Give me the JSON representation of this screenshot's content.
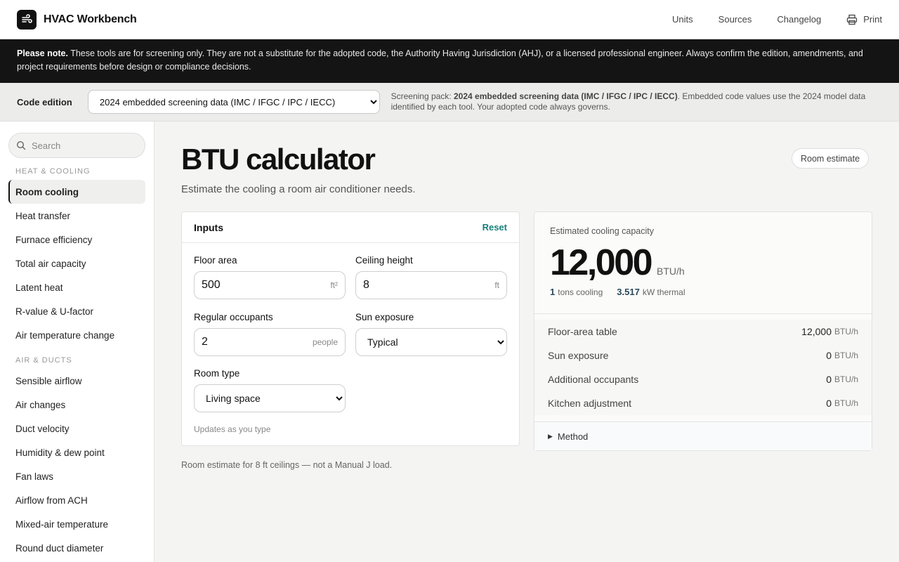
{
  "app": {
    "title": "HVAC Workbench"
  },
  "topnav": {
    "units": "Units",
    "sources": "Sources",
    "changelog": "Changelog",
    "print": "Print"
  },
  "notice": {
    "lead": "Please note.",
    "text": " These tools are for screening only. They are not a substitute for the adopted code, the Authority Having Jurisdiction (AHJ), or a licensed professional engineer. Always confirm the edition, amendments, and project requirements before design or compliance decisions."
  },
  "edition": {
    "label": "Code edition",
    "selected": "2024 embedded screening data (IMC / IFGC / IPC / IECC)",
    "note_prefix": "Screening pack: ",
    "note_bold": "2024 embedded screening data (IMC / IFGC / IPC / IECC)",
    "note_suffix": ". Embedded code values use the 2024 model data identified by each tool. Your adopted code always governs."
  },
  "sidebar": {
    "search_placeholder": "Search",
    "groups": [
      {
        "label": "HEAT & COOLING",
        "items": [
          "Room cooling",
          "Heat transfer",
          "Furnace efficiency",
          "Total air capacity",
          "Latent heat",
          "R-value & U-factor",
          "Air temperature change"
        ]
      },
      {
        "label": "AIR & DUCTS",
        "items": [
          "Sensible airflow",
          "Air changes",
          "Duct velocity",
          "Humidity & dew point",
          "Fan laws",
          "Airflow from ACH",
          "Mixed-air temperature",
          "Round duct diameter"
        ]
      }
    ],
    "active": "Room cooling"
  },
  "main": {
    "title": "BTU calculator",
    "subtitle": "Estimate the cooling a room air conditioner needs.",
    "badge": "Room estimate",
    "footnote": "Room estimate for 8 ft ceilings — not a Manual J load."
  },
  "inputs": {
    "heading": "Inputs",
    "reset": "Reset",
    "floor_area": {
      "label": "Floor area",
      "value": "500",
      "unit": "ft²"
    },
    "ceiling_height": {
      "label": "Ceiling height",
      "value": "8",
      "unit": "ft"
    },
    "occupants": {
      "label": "Regular occupants",
      "value": "2",
      "unit": "people"
    },
    "sun_exposure": {
      "label": "Sun exposure",
      "selected": "Typical"
    },
    "room_type": {
      "label": "Room type",
      "selected": "Living space"
    },
    "status": "Updates as you type"
  },
  "result": {
    "label": "Estimated cooling capacity",
    "value": "12,000",
    "unit": "BTU/h",
    "tons": "1",
    "tons_label": "tons cooling",
    "kw": "3.517",
    "kw_label": "kW thermal",
    "breakdown": [
      {
        "label": "Floor-area table",
        "value": "12,000",
        "unit": "BTU/h"
      },
      {
        "label": "Sun exposure",
        "value": "0",
        "unit": "BTU/h"
      },
      {
        "label": "Additional occupants",
        "value": "0",
        "unit": "BTU/h"
      },
      {
        "label": "Kitchen adjustment",
        "value": "0",
        "unit": "BTU/h"
      }
    ],
    "method": "Method"
  },
  "icons": {
    "logo": "fan-logo-icon",
    "print": "printer-icon",
    "search": "search-icon",
    "method": "disclosure-triangle-icon"
  }
}
